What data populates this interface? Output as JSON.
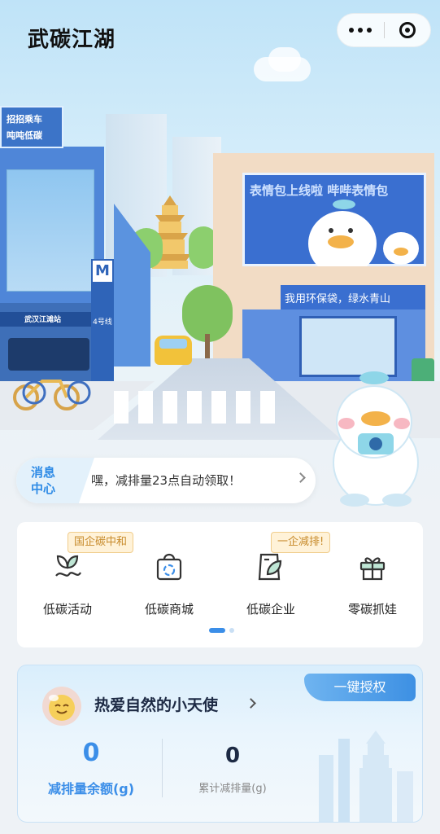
{
  "header": {
    "title": "武碳江湖",
    "more_icon": "more-dots-icon",
    "close_icon": "target-close-icon"
  },
  "scene": {
    "banner_left_line1": "招招乘车",
    "banner_left_line2": "吨吨低碳",
    "billboard_text": "表情包上线啦 哔哔表情包",
    "shop_sign": "我用环保袋，绿水青山",
    "metro_sign": "M",
    "metro_station": "武汉江滩站",
    "metro_line": "4号线"
  },
  "message": {
    "badge_line1": "消息",
    "badge_line2": "中心",
    "text": "嘿，减排量23点自动领取！"
  },
  "menu": {
    "items": [
      {
        "label": "低碳活动",
        "tag": "国企碳中和",
        "icon": "sprout-icon"
      },
      {
        "label": "低碳商城",
        "tag": "",
        "icon": "shopping-bag-icon"
      },
      {
        "label": "低碳企业",
        "tag": "一企减排!",
        "icon": "leaf-cup-icon"
      },
      {
        "label": "零碳抓娃",
        "tag": "",
        "icon": "gift-box-icon"
      }
    ],
    "page": 1,
    "pages": 2
  },
  "account": {
    "auth_button": "一键授权",
    "nickname": "热爱自然的小天使",
    "balance_value": "0",
    "balance_label": "减排量余额(g)",
    "total_value": "0",
    "total_label": "累计减排量(g)"
  },
  "colors": {
    "accent": "#3b8ee8",
    "tag_text": "#c78a2a",
    "tag_bg": "#fff2d8"
  }
}
